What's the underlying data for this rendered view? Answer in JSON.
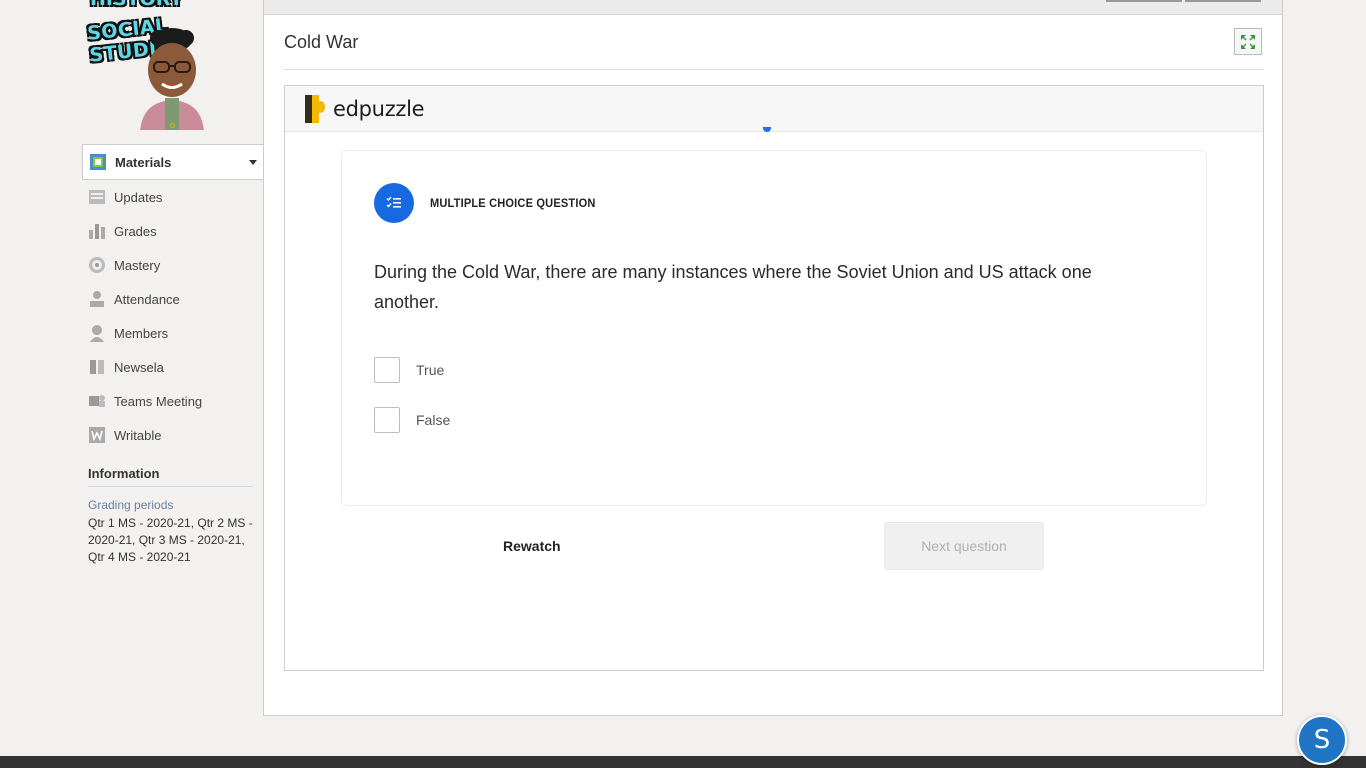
{
  "logo": {
    "line1": "HISTORY",
    "line2": "SOCIAL STUDIES"
  },
  "sidebar": {
    "items": [
      {
        "label": "Materials",
        "icon": "materials-icon",
        "active": true
      },
      {
        "label": "Updates",
        "icon": "updates-icon"
      },
      {
        "label": "Grades",
        "icon": "grades-icon"
      },
      {
        "label": "Mastery",
        "icon": "mastery-icon"
      },
      {
        "label": "Attendance",
        "icon": "attendance-icon"
      },
      {
        "label": "Members",
        "icon": "members-icon"
      },
      {
        "label": "Newsela",
        "icon": "newsela-icon"
      },
      {
        "label": "Teams Meeting",
        "icon": "teams-icon"
      },
      {
        "label": "Writable",
        "icon": "writable-icon"
      }
    ]
  },
  "info": {
    "title": "Information",
    "grading_label": "Grading periods",
    "grading_value": "Qtr 1 MS - 2020-21, Qtr 2 MS - 2020-21, Qtr 3 MS - 2020-21, Qtr 4 MS - 2020-21"
  },
  "main": {
    "title": "Cold War"
  },
  "edpuzzle": {
    "brand": "edpuzzle",
    "question_type": "MULTIPLE CHOICE QUESTION",
    "question": "During the Cold War, there are many instances where the Soviet Union and US attack one another.",
    "options": [
      "True",
      "False"
    ],
    "rewatch_label": "Rewatch",
    "next_label": "Next question"
  },
  "chat": {
    "letter": "S"
  },
  "colors": {
    "accent": "#1769e0",
    "brand_yellow": "#f5b800",
    "footer": "#333333"
  }
}
